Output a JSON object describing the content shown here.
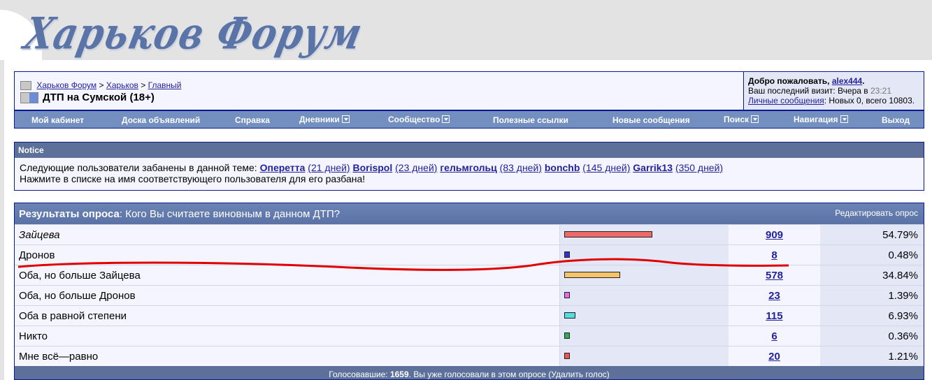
{
  "site": {
    "logo_text": "Харьков Форум"
  },
  "breadcrumb": {
    "items": [
      "Харьков Форум",
      "Харьков",
      "Главный"
    ],
    "separator": ">"
  },
  "thread": {
    "title": "ДТП на Сумской (18+)"
  },
  "welcome": {
    "greeting": "Добро пожаловать,",
    "username": "alex444",
    "last_visit_label": "Ваш последний визит: Вчера в",
    "last_visit_time": "23:21",
    "pm_link": "Личные сообщения",
    "pm_status": ": Новых 0, всего 10803."
  },
  "menu": {
    "items": [
      {
        "label": "Мой кабинет",
        "dropdown": false
      },
      {
        "label": "Доска объявлений",
        "dropdown": false
      },
      {
        "label": "Справка",
        "dropdown": false
      },
      {
        "label": "Дневники",
        "dropdown": true
      },
      {
        "label": "Сообщество",
        "dropdown": true
      },
      {
        "label": "Полезные ссылки",
        "dropdown": false
      },
      {
        "label": "Новые сообщения",
        "dropdown": false
      },
      {
        "label": "Поиск",
        "dropdown": true
      },
      {
        "label": "Навигация",
        "dropdown": true
      },
      {
        "label": "Выход",
        "dropdown": false
      }
    ]
  },
  "notice": {
    "title": "Notice",
    "line1_prefix": "Следующие пользователи забанены в данной теме:",
    "banned": [
      {
        "name": "Оперетта",
        "days": "(21 дней)"
      },
      {
        "name": "Borispol",
        "days": "(23 дней)"
      },
      {
        "name": "гельмгольц",
        "days": "(83 дней)"
      },
      {
        "name": "bonchb",
        "days": "(145 дней)"
      },
      {
        "name": "Garrik13",
        "days": "(350 дней)"
      }
    ],
    "line2": "Нажмите в списке на имя соответствующего пользователя для его разбана!"
  },
  "poll": {
    "title_bold": "Результаты опроса",
    "question": ": Кого Вы считаете виновным в данном ДТП?",
    "edit_link": "Редактировать опрос",
    "options": [
      {
        "label": "Зайцева",
        "italic": true,
        "votes": "909",
        "percent": "54.79%",
        "share": 54.79,
        "color": "#f06a6a"
      },
      {
        "label": "Дронов",
        "italic": false,
        "votes": "8",
        "percent": "0.48%",
        "share": 0.48,
        "color": "#3333cc"
      },
      {
        "label": "Оба, но больше Зайцева",
        "italic": false,
        "votes": "578",
        "percent": "34.84%",
        "share": 34.84,
        "color": "#f5c36b"
      },
      {
        "label": "Оба, но больше Дронов",
        "italic": false,
        "votes": "23",
        "percent": "1.39%",
        "share": 1.39,
        "color": "#e66be6"
      },
      {
        "label": "Оба в равной степени",
        "italic": false,
        "votes": "115",
        "percent": "6.93%",
        "share": 6.93,
        "color": "#55dddd"
      },
      {
        "label": "Никто",
        "italic": false,
        "votes": "6",
        "percent": "0.36%",
        "share": 0.36,
        "color": "#33aa55"
      },
      {
        "label": "Мне всё—равно",
        "italic": false,
        "votes": "20",
        "percent": "1.21%",
        "share": 1.21,
        "color": "#ee5555"
      }
    ],
    "footer_prefix": "Голосовавшие:",
    "footer_total": "1659",
    "footer_suffix": ". Вы уже голосовали в этом опросе (Удалить голос)"
  }
}
